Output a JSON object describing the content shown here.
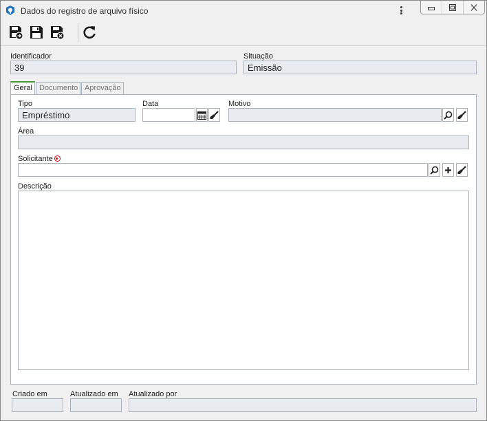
{
  "window": {
    "title": "Dados do registro de arquivo físico"
  },
  "toolbar": {
    "buttons": [
      {
        "name": "save-new-button",
        "icon": "save-arrow-icon"
      },
      {
        "name": "save-button",
        "icon": "save-icon"
      },
      {
        "name": "save-close-button",
        "icon": "save-x-icon"
      },
      {
        "name": "refresh-button",
        "icon": "refresh-icon"
      }
    ]
  },
  "header": {
    "identificador_label": "Identificador",
    "identificador_value": "39",
    "situacao_label": "Situação",
    "situacao_value": "Emissão"
  },
  "tabs": [
    {
      "label": "Geral",
      "active": true
    },
    {
      "label": "Documento",
      "active": false
    },
    {
      "label": "Aprovação",
      "active": false
    }
  ],
  "geral": {
    "tipo_label": "Tipo",
    "tipo_value": "Empréstimo",
    "data_label": "Data",
    "data_value": "",
    "motivo_label": "Motivo",
    "motivo_value": "",
    "area_label": "Área",
    "area_value": "",
    "solicitante_label": "Solicitante",
    "solicitante_value": "",
    "descricao_label": "Descrição",
    "descricao_value": ""
  },
  "footer": {
    "criado_em_label": "Criado em",
    "criado_em_value": "",
    "atualizado_em_label": "Atualizado em",
    "atualizado_em_value": "",
    "atualizado_por_label": "Atualizado por",
    "atualizado_por_value": ""
  },
  "colors": {
    "active_tab_accent": "#4a9a3a",
    "required_marker": "#dd0000",
    "readonly_field_bg": "#e8ecf0"
  }
}
